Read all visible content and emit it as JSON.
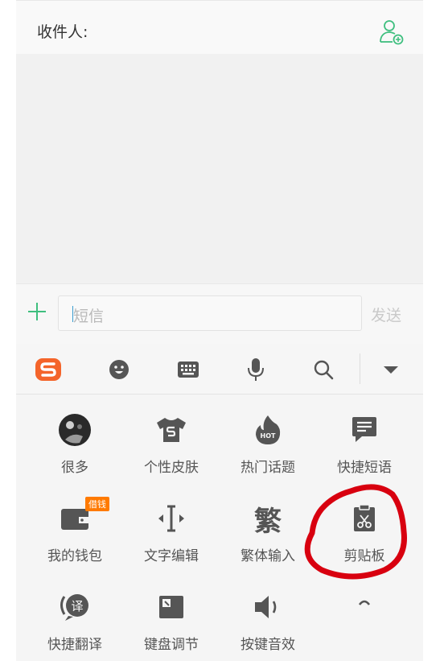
{
  "recipient": {
    "label": "收件人:"
  },
  "composer": {
    "placeholder": "短信",
    "send_label": "发送"
  },
  "toolbar": {
    "icons": [
      "sogou-logo-icon",
      "emoji-icon",
      "keyboard-icon",
      "microphone-icon",
      "search-icon",
      "collapse-icon"
    ]
  },
  "grid": {
    "items": [
      {
        "label": "很多"
      },
      {
        "label": "个性皮肤"
      },
      {
        "label": "热门话题"
      },
      {
        "label": "快捷短语"
      },
      {
        "label": "我的钱包",
        "badge": "借钱"
      },
      {
        "label": "文字编辑"
      },
      {
        "label": "繁体输入",
        "glyph": "繁"
      },
      {
        "label": "剪贴板"
      },
      {
        "label": "快捷翻译",
        "glyph": "译"
      },
      {
        "label": "键盘调节"
      },
      {
        "label": "按键音效"
      }
    ]
  },
  "colors": {
    "accent": "#3fbf7f",
    "sogou": "#f4642a",
    "annotation": "#d8000f"
  }
}
